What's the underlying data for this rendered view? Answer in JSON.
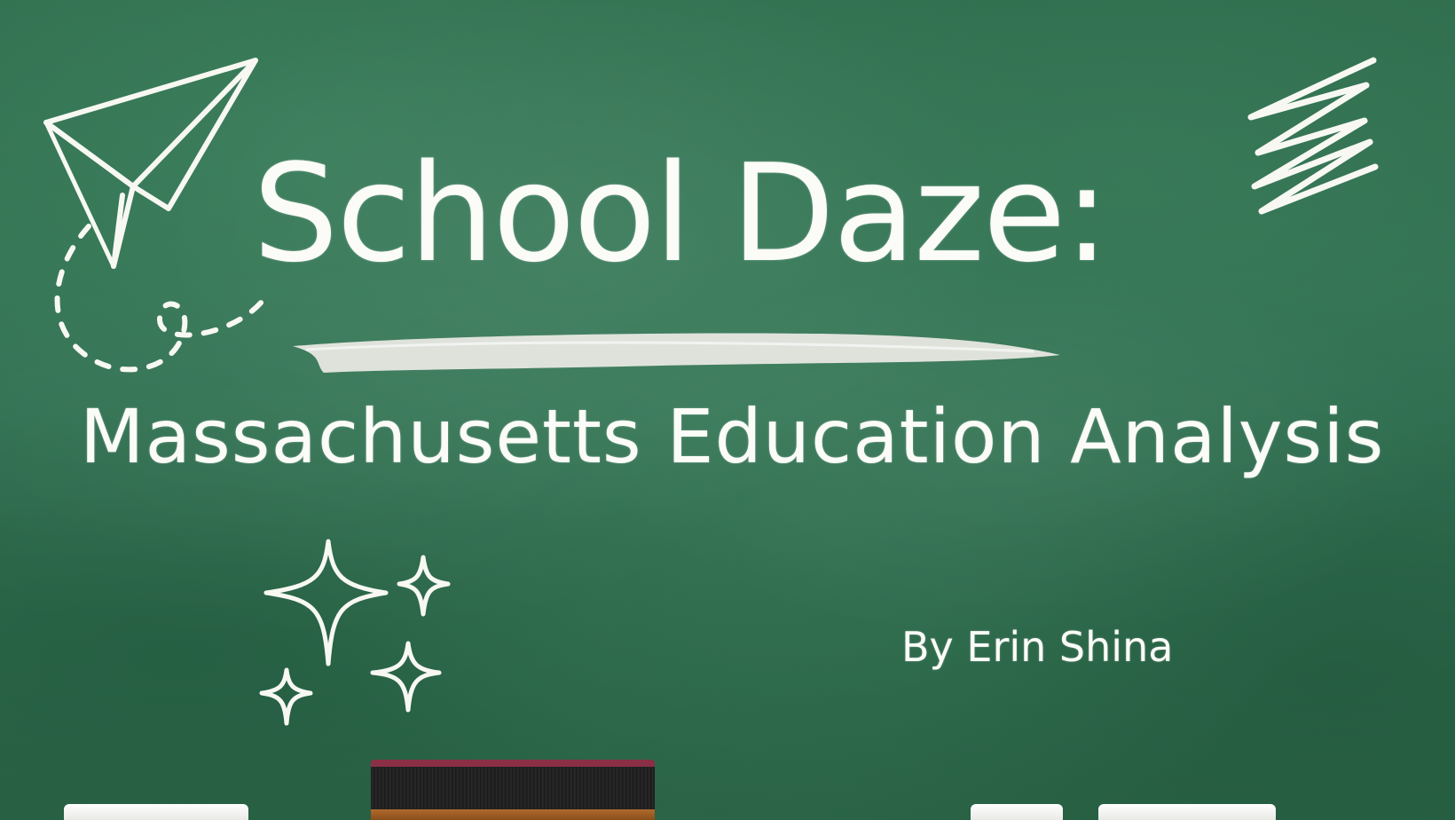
{
  "slide": {
    "title": "School Daze:",
    "subtitle": "Massachusetts Education Analysis",
    "author": "By Erin Shina"
  },
  "colors": {
    "chalkboard": "#2f6b4c",
    "chalk": "#fbfbf7",
    "eraser_felt": "#8a2f45",
    "eraser_wood": "#b06a2c"
  },
  "decorations": [
    "paper-airplane-icon",
    "scribble-icon",
    "sparkles-icon",
    "chalk-underline"
  ]
}
